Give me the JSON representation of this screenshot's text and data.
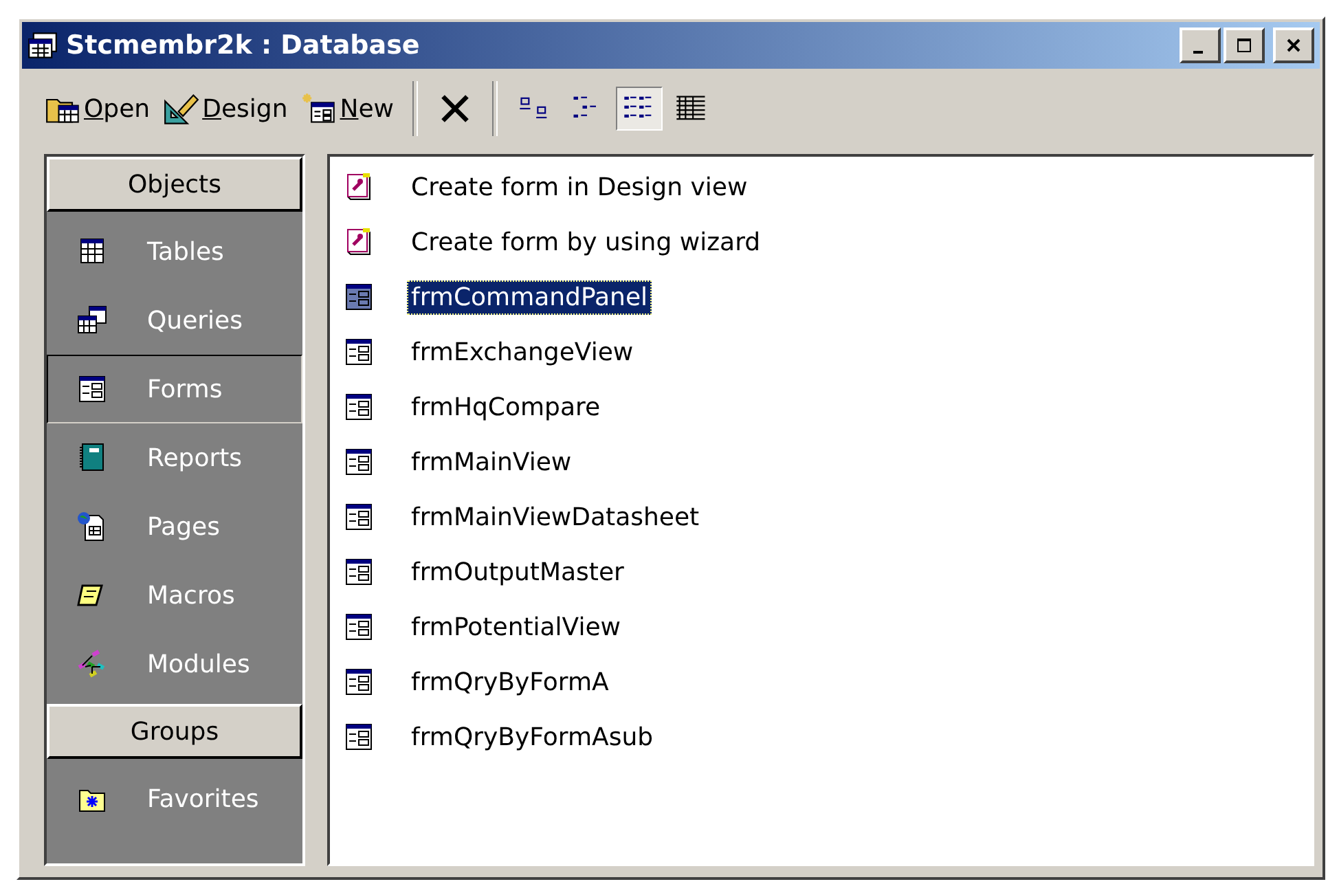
{
  "window": {
    "title": "Stcmembr2k : Database"
  },
  "toolbar": [
    {
      "kind": "open",
      "label": "Open"
    },
    {
      "kind": "design",
      "label": "Design"
    },
    {
      "kind": "new",
      "label": "New"
    },
    {
      "kind": "delete"
    },
    {
      "kind": "view",
      "selected": false
    },
    {
      "kind": "view",
      "selected": false
    },
    {
      "kind": "view",
      "selected": true
    },
    {
      "kind": "view",
      "selected": false
    }
  ],
  "sidebar": {
    "groups": [
      {
        "header": "Objects",
        "items": [
          {
            "label": "Tables",
            "selected": false
          },
          {
            "label": "Queries",
            "selected": false
          },
          {
            "label": "Forms",
            "selected": true
          },
          {
            "label": "Reports",
            "selected": false
          },
          {
            "label": "Pages",
            "selected": false
          },
          {
            "label": "Macros",
            "selected": false
          },
          {
            "label": "Modules",
            "selected": false
          }
        ]
      },
      {
        "header": "Groups",
        "items": [
          {
            "label": "Favorites",
            "selected": false
          }
        ]
      }
    ]
  },
  "list": [
    {
      "kind": "shortcut",
      "label": "Create form in Design view",
      "selected": false
    },
    {
      "kind": "shortcut",
      "label": "Create form by using wizard",
      "selected": false
    },
    {
      "kind": "form",
      "label": "frmCommandPanel",
      "selected": true
    },
    {
      "kind": "form",
      "label": "frmExchangeView",
      "selected": false
    },
    {
      "kind": "form",
      "label": "frmHqCompare",
      "selected": false
    },
    {
      "kind": "form",
      "label": "frmMainView",
      "selected": false
    },
    {
      "kind": "form",
      "label": "frmMainViewDatasheet",
      "selected": false
    },
    {
      "kind": "form",
      "label": "frmOutputMaster",
      "selected": false
    },
    {
      "kind": "form",
      "label": "frmPotentialView",
      "selected": false
    },
    {
      "kind": "form",
      "label": "frmQryByFormA",
      "selected": false
    },
    {
      "kind": "form",
      "label": "frmQryByFormAsub",
      "selected": false
    }
  ]
}
